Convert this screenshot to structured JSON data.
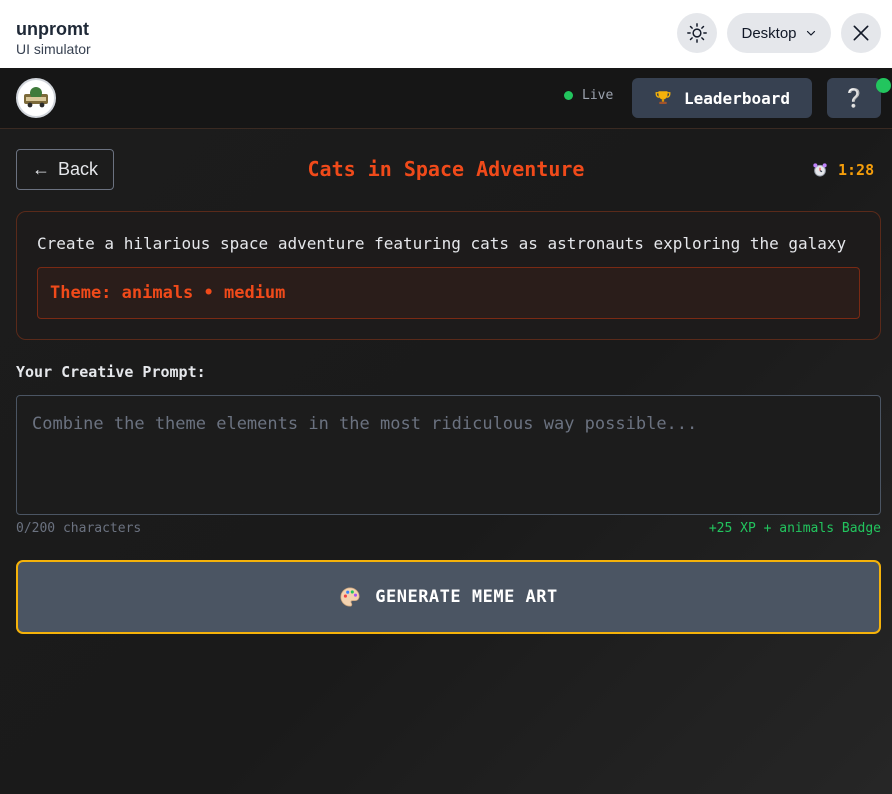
{
  "simulator": {
    "title": "unpromt",
    "subtitle": "UI simulator",
    "device_label": "Desktop"
  },
  "header": {
    "live_label": "Live",
    "leaderboard_label": "Leaderboard",
    "help_icon": "question-mark-icon",
    "live_color": "#22c55e"
  },
  "challenge": {
    "back_label": "Back",
    "title": "Cats in Space Adventure",
    "timer": "1:28",
    "description": "Create a hilarious space adventure featuring cats as astronauts exploring the galaxy",
    "theme_line": "Theme: animals • medium"
  },
  "prompt": {
    "label": "Your Creative Prompt:",
    "placeholder": "Combine the theme elements in the most ridiculous way possible...",
    "value": "",
    "char_count": "0/200 characters",
    "reward": "+25 XP + animals Badge"
  },
  "generate": {
    "label": "GENERATE MEME ART",
    "icon": "palette-icon"
  },
  "colors": {
    "accent": "#f04a1a",
    "timer": "#f59e0b",
    "button_border": "#f5b20a",
    "success": "#22c55e"
  }
}
